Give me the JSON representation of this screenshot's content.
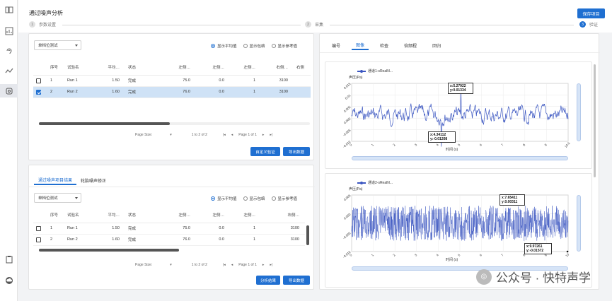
{
  "page": {
    "title": "通过噪声分析",
    "save_label": "保存项目"
  },
  "steps": [
    {
      "num": "1",
      "label": "参数设置"
    },
    {
      "num": "2",
      "label": "采集"
    },
    {
      "num": "3",
      "label": "验证"
    }
  ],
  "top_panel": {
    "select_value": "单档位测试",
    "radios": [
      {
        "label": "显示平均值",
        "on": true
      },
      {
        "label": "显示包络",
        "on": false
      },
      {
        "label": "显示参考值",
        "on": false
      }
    ],
    "columns": [
      "序号",
      "试验名",
      "平均…",
      "状态",
      "左侧…",
      "左侧…",
      "左侧…",
      "右侧…",
      "右侧"
    ],
    "rows": [
      {
        "no": "1",
        "name": "Run 1",
        "avg": "1.50",
        "status": "完成",
        "c1": "75.0",
        "c2": "0.0",
        "c3": "1",
        "c4": "3100",
        "checked": false
      },
      {
        "no": "2",
        "name": "Run 2",
        "avg": "1.60",
        "status": "完成",
        "c1": "76.0",
        "c2": "0.0",
        "c3": "1",
        "c4": "3100",
        "checked": true
      }
    ],
    "pager": {
      "size_label": "Page Size:",
      "range": "1 to 2 of 2",
      "page": "Page 1 of 1"
    },
    "btn_custom": "自定义验证",
    "btn_export": "导出数据"
  },
  "bottom_panel": {
    "tabs": [
      "通过噪声项目结果",
      "轮胎噪声修正"
    ],
    "select_value": "单档位测试",
    "radios": [
      {
        "label": "显示平均值",
        "on": true
      },
      {
        "label": "显示包络",
        "on": false
      },
      {
        "label": "显示参考值",
        "on": false
      }
    ],
    "columns": [
      "序号",
      "试验名",
      "平均…",
      "状态",
      "左侧…",
      "左侧…",
      "左侧…",
      "右侧…"
    ],
    "rows": [
      {
        "no": "1",
        "name": "Run 1",
        "avg": "1.50",
        "status": "完成",
        "c1": "75.0",
        "c2": "0.0",
        "c3": "1",
        "c4": "3100",
        "checked": false
      },
      {
        "no": "2",
        "name": "Run 2",
        "avg": "1.60",
        "status": "完成",
        "c1": "76.0",
        "c2": "0.0",
        "c3": "1",
        "c4": "3100",
        "checked": false
      }
    ],
    "pager": {
      "size_label": "Page Size:",
      "range": "1 to 2 of 2",
      "page": "Page 1 of 1"
    },
    "btn_analyze": "分析结果",
    "btn_export": "导出数据"
  },
  "right_panel": {
    "tabs": [
      "编号",
      "图像",
      "检查",
      "倍频程",
      "回归"
    ],
    "active_tab": 1
  },
  "watermark": "公众号 · 快特声学",
  "colors": {
    "accent": "#1f6fd1",
    "series": "#3b56c1"
  },
  "chart_data": [
    {
      "type": "line",
      "series": [
        {
          "name": "通道1-sRealN..."
        }
      ],
      "ylabel": "声压(Pa)",
      "xlabel": "时间 (s)",
      "xlim": [
        0,
        10
      ],
      "ylim": [
        -0.01,
        0.015
      ],
      "yticks": [
        "0.015",
        "0.01",
        "0.005",
        "0.000",
        "-0.005",
        "-0.010"
      ],
      "xticks": [
        "0",
        "1",
        "2",
        "3",
        "4",
        "5",
        "6",
        "7",
        "8",
        "9",
        "10.5"
      ],
      "annotations": [
        {
          "text": "x:5.27922 y:0.01334",
          "x": 5.28,
          "y": 0.01334
        },
        {
          "text": "x:4.34112 y:-0.01208",
          "x": 4.34,
          "y": -0.01208
        }
      ]
    },
    {
      "type": "line",
      "series": [
        {
          "name": "通道2-sRealN..."
        }
      ],
      "ylabel": "声压(Pa)",
      "xlabel": "时间 (s)",
      "xlim": [
        0,
        10
      ],
      "ylim": [
        -0.01,
        0.005
      ],
      "yticks": [
        "0.005",
        "0.000",
        "-0.005",
        "-0.010"
      ],
      "xticks": [
        "0",
        "1",
        "2",
        "3",
        "4",
        "5",
        "6",
        "7",
        "8",
        "9",
        "10"
      ],
      "annotations": [
        {
          "text": "x:7.65411 y:0.00311",
          "x": 7.65,
          "y": 0.00311
        },
        {
          "text": "x:9.97261 y:-0.01572",
          "x": 9.97,
          "y": -0.01572
        }
      ]
    }
  ]
}
